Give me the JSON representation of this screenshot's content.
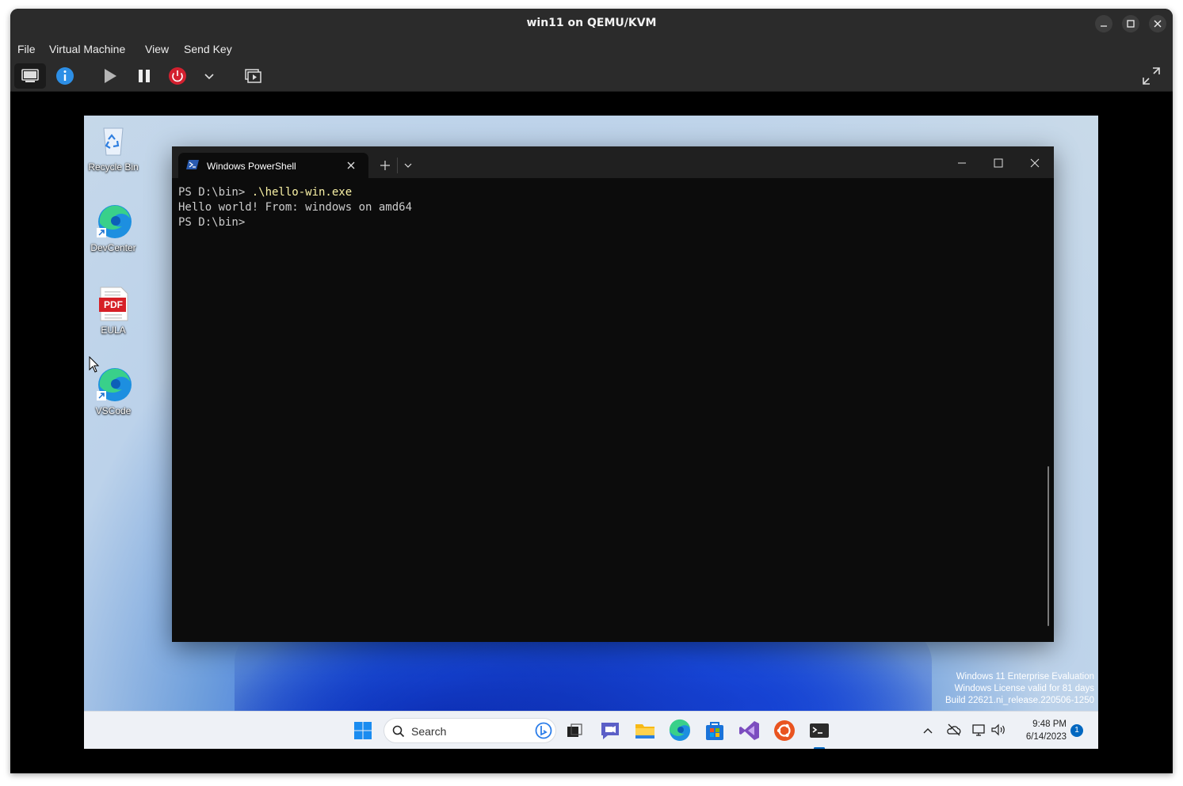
{
  "host": {
    "title": "win11 on QEMU/KVM",
    "menu": [
      "File",
      "Virtual Machine",
      "View",
      "Send Key"
    ],
    "window_controls": [
      "minimize-icon",
      "maximize-icon",
      "close-icon"
    ],
    "toolbar_icons": [
      "console-icon",
      "details-info-icon",
      "run-play-icon",
      "pause-icon",
      "power-icon",
      "chevron-down-icon",
      "snapshots-icon",
      "fullscreen-icon"
    ],
    "colors": {
      "titlebar": "#2b2b2b",
      "info_blue": "#2d8fe6",
      "power_red": "#d3202f"
    }
  },
  "desktop": {
    "icons": [
      {
        "label": "Recycle Bin"
      },
      {
        "label": "DevCenter"
      },
      {
        "label": "EULA",
        "badge": "PDF"
      },
      {
        "label": "VSCode"
      }
    ],
    "watermark": [
      "Windows 11 Enterprise Evaluation",
      "Windows License valid for 81 days",
      "Build 22621.ni_release.220506-1250"
    ]
  },
  "terminal": {
    "tab_title": "Windows PowerShell",
    "lines": [
      {
        "prompt": "PS D:\\bin> ",
        "cmd": ".\\hello-win.exe"
      },
      {
        "text": "Hello world! From: windows on amd64"
      },
      {
        "prompt": "PS D:\\bin>",
        "cmd": ""
      }
    ]
  },
  "taskbar": {
    "search_placeholder": "Search",
    "apps": [
      "start-icon",
      "task-view-icon",
      "teams-chat-icon",
      "file-explorer-icon",
      "edge-icon",
      "store-icon",
      "visual-studio-icon",
      "ubuntu-icon",
      "terminal-icon"
    ],
    "tray": [
      "show-hidden-icons-chevron",
      "onedrive-icon",
      "network-icon",
      "volume-icon"
    ],
    "time": "9:48 PM",
    "date": "6/14/2023",
    "notification_count": "1"
  }
}
